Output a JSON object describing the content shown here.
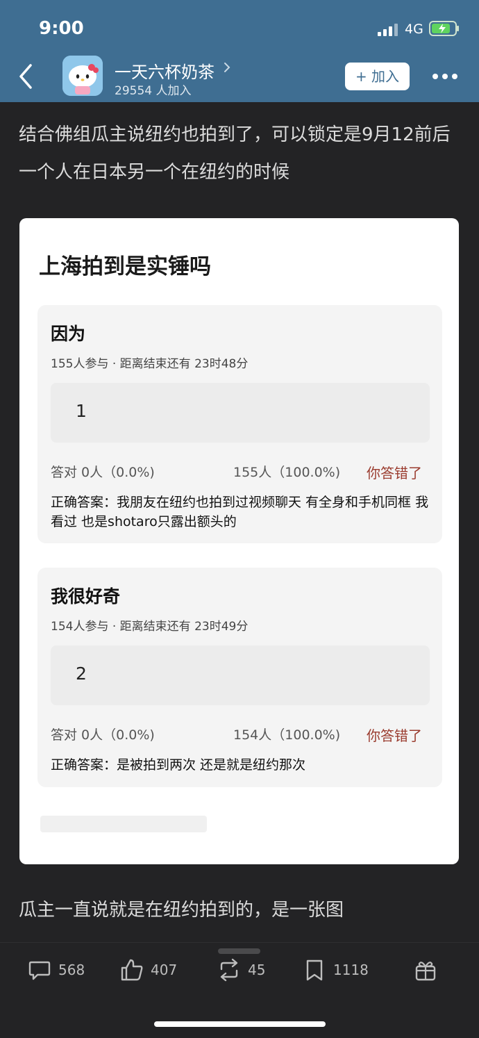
{
  "status_bar": {
    "time": "9:00",
    "network": "4G"
  },
  "header": {
    "group_name": "一天六杯奶茶",
    "members": "29554 人加入",
    "join_button": "+ 加入"
  },
  "post": {
    "text_top": "结合佛组瓜主说纽约也拍到了，可以锁定是9月12前后 一个人在日本另一个在纽约的时候",
    "text_bottom": "瓜主一直说就是在纽约拍到的，是一张图"
  },
  "card": {
    "title": "上海拍到是实锤吗",
    "quizzes": [
      {
        "title": "因为",
        "participants": "155人参与",
        "separator": " · ",
        "time_left": "距离结束还有 23时48分",
        "option": "1",
        "correct_stat": "答对  0人（0.0%)",
        "wrong_stat": "155人（100.0%)",
        "result": "你答错了",
        "answer": "正确答案：我朋友在纽约也拍到过视频聊天 有全身和手机同框 我看过 也是shotaro只露出额头的"
      },
      {
        "title": "我很好奇",
        "participants": "154人参与",
        "separator": " · ",
        "time_left": "距离结束还有 23时49分",
        "option": "2",
        "correct_stat": "答对  0人（0.0%)",
        "wrong_stat": "154人（100.0%)",
        "result": "你答错了",
        "answer": "正确答案：是被拍到两次 还是就是纽约那次"
      }
    ]
  },
  "toolbar": {
    "comments": "568",
    "likes": "407",
    "reposts": "45",
    "favorites": "1118"
  }
}
